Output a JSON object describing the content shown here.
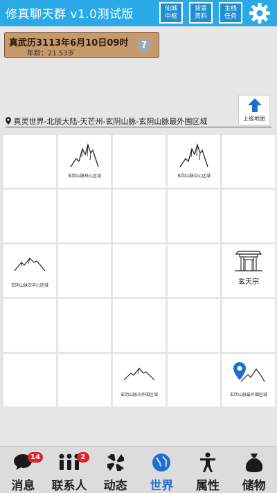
{
  "header": {
    "title": "修真聊天群 v1.0测试版",
    "buttons": [
      {
        "label": "仙城中枢"
      },
      {
        "label": "背景资料"
      },
      {
        "label": "主线任务"
      }
    ],
    "settings_icon": "gear-icon",
    "colors": {
      "bar": "#29a9e6"
    }
  },
  "date_panel": {
    "date": "真武历3113年6月10日09时",
    "age": "年龄：21.53岁",
    "help_label": "?"
  },
  "up_button": {
    "label": "上级地图",
    "icon": "arrow-up-icon"
  },
  "location": {
    "icon": "map-pin-icon",
    "path": "真灵世界-北辰大陆-天芒州-玄阴山脉-玄阴山脉最外围区域"
  },
  "grid": {
    "columns": 5,
    "rows": 5,
    "cells": [
      {
        "label": ""
      },
      {
        "label": "玄阴山脉核心区域",
        "icon": "mountain-icon"
      },
      {
        "label": ""
      },
      {
        "label": "玄阴山脉中心区域",
        "icon": "mountain-icon"
      },
      {
        "label": ""
      },
      {
        "label": ""
      },
      {
        "label": ""
      },
      {
        "label": ""
      },
      {
        "label": ""
      },
      {
        "label": ""
      },
      {
        "label": "玄阴山脉次中心区域",
        "icon": "hill-icon"
      },
      {
        "label": ""
      },
      {
        "label": ""
      },
      {
        "label": ""
      },
      {
        "label": "玄天宗",
        "icon": "sect-gate-icon"
      },
      {
        "label": ""
      },
      {
        "label": ""
      },
      {
        "label": ""
      },
      {
        "label": ""
      },
      {
        "label": ""
      },
      {
        "label": ""
      },
      {
        "label": ""
      },
      {
        "label": "玄阴山脉次外围区域",
        "icon": "hill-icon"
      },
      {
        "label": ""
      },
      {
        "label": "玄阴山脉最外围区域",
        "icon": "current-location-mountain-icon"
      }
    ]
  },
  "nav": {
    "items": [
      {
        "label": "消息",
        "icon": "chat-icon",
        "badge": "14"
      },
      {
        "label": "联系人",
        "icon": "contacts-icon",
        "badge": "2"
      },
      {
        "label": "动态",
        "icon": "moments-icon"
      },
      {
        "label": "世界",
        "icon": "world-icon",
        "active": true
      },
      {
        "label": "属性",
        "icon": "person-icon"
      },
      {
        "label": "储物",
        "icon": "bag-icon"
      }
    ],
    "colors": {
      "active": "#1f6fd1"
    }
  }
}
